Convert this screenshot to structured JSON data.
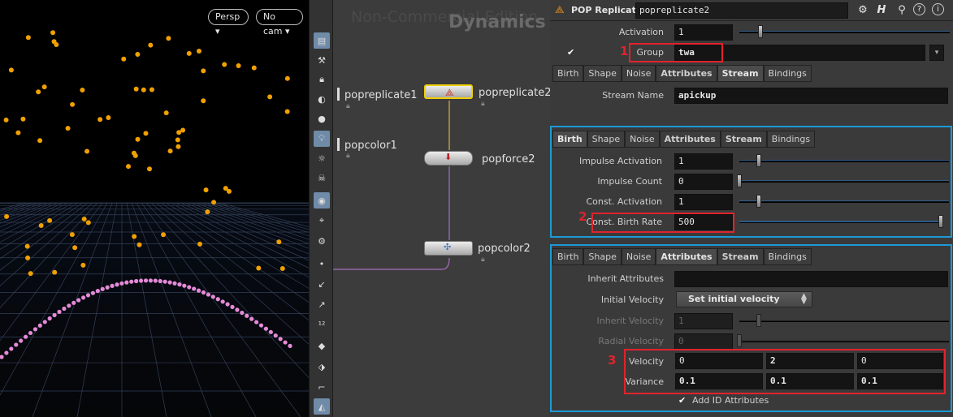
{
  "viewport": {
    "persp_label": "Persp ▾",
    "cam_label": "No cam ▾",
    "colors": {
      "particle": "#f0a000",
      "arc": "#e58ad8",
      "grid": "#324058"
    }
  },
  "network": {
    "watermark": "Non-Commercial Edition",
    "context": "Dynamics",
    "nodes": {
      "popreplicate1": "popreplicate1",
      "popcolor1": "popcolor1",
      "popreplicate2": "popreplicate2",
      "popforce2": "popforce2",
      "popcolor2": "popcolor2"
    }
  },
  "params": {
    "header": {
      "type": "POP Replicate",
      "name": "popreplicate2",
      "h_icon": "H"
    },
    "activation": {
      "label": "Activation",
      "value": "1"
    },
    "group": {
      "label": "Group",
      "value": "twa",
      "marker": "1"
    },
    "tabs1": [
      "Birth",
      "Shape",
      "Noise",
      "Attributes",
      "Stream",
      "Bindings"
    ],
    "stream_name": {
      "label": "Stream Name",
      "value": "apickup"
    },
    "tabs2": [
      "Birth",
      "Shape",
      "Noise",
      "Attributes",
      "Stream",
      "Bindings"
    ],
    "birth": {
      "impulse_activation": {
        "label": "Impulse Activation",
        "value": "1"
      },
      "impulse_count": {
        "label": "Impulse Count",
        "value": "0"
      },
      "const_activation": {
        "label": "Const. Activation",
        "value": "1"
      },
      "const_birth_rate": {
        "label": "Const. Birth Rate",
        "value": "500",
        "marker": "2"
      }
    },
    "tabs3": [
      "Birth",
      "Shape",
      "Noise",
      "Attributes",
      "Stream",
      "Bindings"
    ],
    "attributes": {
      "inherit_attributes": {
        "label": "Inherit Attributes",
        "value": ""
      },
      "initial_velocity": {
        "label": "Initial Velocity",
        "value": "Set initial velocity"
      },
      "inherit_velocity": {
        "label": "Inherit Velocity",
        "value": "1"
      },
      "radial_velocity": {
        "label": "Radial Velocity",
        "value": "0"
      },
      "velocity": {
        "label": "Velocity",
        "values": [
          "0",
          "2",
          "0"
        ],
        "marker": "3"
      },
      "variance": {
        "label": "Variance",
        "values": [
          "0.1",
          "0.1",
          "0.1"
        ]
      },
      "add_id": {
        "label": "Add ID Attributes"
      }
    }
  }
}
